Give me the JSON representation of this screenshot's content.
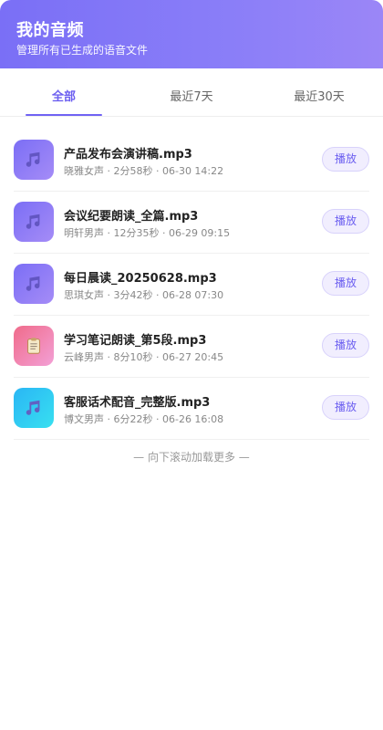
{
  "header": {
    "title": "我的音频",
    "subtitle": "管理所有已生成的语音文件"
  },
  "tabs": [
    {
      "label": "全部",
      "active": true
    },
    {
      "label": "最近7天",
      "active": false
    },
    {
      "label": "最近30天",
      "active": false
    }
  ],
  "items": [
    {
      "icon": "music-note-icon",
      "thumb_color": "purple",
      "name": "产品发布会演讲稿.mp3",
      "meta": "晓雅女声 · 2分58秒 · 06-30 14:22",
      "action": "播放"
    },
    {
      "icon": "music-note-icon",
      "thumb_color": "purple",
      "name": "会议纪要朗读_全篇.mp3",
      "meta": "明轩男声 · 12分35秒 · 06-29 09:15",
      "action": "播放"
    },
    {
      "icon": "music-note-icon",
      "thumb_color": "purple",
      "name": "每日晨读_20250628.mp3",
      "meta": "思琪女声 · 3分42秒 · 06-28 07:30",
      "action": "播放"
    },
    {
      "icon": "clipboard-icon",
      "thumb_color": "pink",
      "name": "学习笔记朗读_第5段.mp3",
      "meta": "云峰男声 · 8分10秒 · 06-27 20:45",
      "action": "播放"
    },
    {
      "icon": "music-note-icon",
      "thumb_color": "cyan",
      "name": "客服话术配音_完整版.mp3",
      "meta": "博文男声 · 6分22秒 · 06-26 16:08",
      "action": "播放"
    }
  ],
  "load_more": "— 向下滚动加载更多 —",
  "colors": {
    "accent": "#6b5ef0",
    "header_start": "#7a6ff6",
    "header_end": "#9b86f7"
  }
}
